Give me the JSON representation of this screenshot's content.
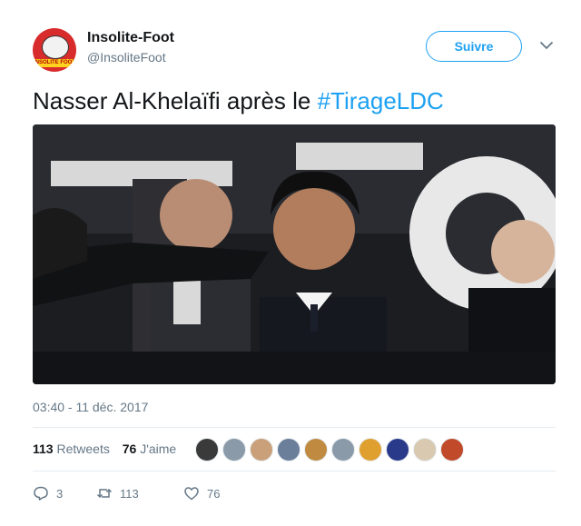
{
  "author": {
    "name": "Insolite-Foot",
    "handle": "@InsoliteFoot",
    "avatar_text": "INSOLITE FOOT"
  },
  "follow_label": "Suivre",
  "tweet": {
    "text": "Nasser Al-Khelaïfi après le ",
    "hashtag": "#TirageLDC"
  },
  "photo": {
    "icon": "photo"
  },
  "timestamp": "03:40 - 11 déc. 2017",
  "stats": {
    "retweets_count": "113",
    "retweets_label": "Retweets",
    "likes_count": "76",
    "likes_label": "J'aime"
  },
  "likers": [
    {
      "color": "#3a3a3a"
    },
    {
      "color": "#8a9aa8"
    },
    {
      "color": "#c9a07a"
    },
    {
      "color": "#6b7e9a"
    },
    {
      "color": "#c08a40"
    },
    {
      "color": "#8a9aa8"
    },
    {
      "color": "#e0a030"
    },
    {
      "color": "#2a3a8a"
    },
    {
      "color": "#d9c9b0"
    },
    {
      "color": "#c04a2a"
    }
  ],
  "actions": {
    "reply_count": "3",
    "retweet_count": "113",
    "like_count": "76"
  },
  "colors": {
    "accent": "#1da1f2",
    "text": "#14171a",
    "muted": "#657786",
    "divider": "#e6ecf0"
  }
}
